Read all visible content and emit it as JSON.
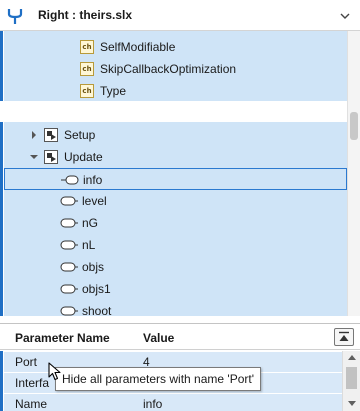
{
  "header": {
    "title": "Right : theirs.slx",
    "app_icon": "merge-fork-icon",
    "menu_icon": "chevron-down-icon"
  },
  "tree": {
    "top_items": [
      {
        "label": "SelfModifiable",
        "icon": "ch"
      },
      {
        "label": "SkipCallbackOptimization",
        "icon": "ch"
      },
      {
        "label": "Type",
        "icon": "ch"
      }
    ],
    "groups": [
      {
        "label": "Setup",
        "expanded": false
      },
      {
        "label": "Update",
        "expanded": true
      }
    ],
    "signals": [
      {
        "label": "info",
        "selected": true
      },
      {
        "label": "level"
      },
      {
        "label": "nG"
      },
      {
        "label": "nL"
      },
      {
        "label": "objs"
      },
      {
        "label": "objs1"
      },
      {
        "label": "shoot"
      }
    ]
  },
  "params": {
    "col_name": "Parameter Name",
    "col_value": "Value",
    "rows": [
      {
        "name": "Port",
        "value": "4"
      },
      {
        "name": "Interfa",
        "value": ""
      },
      {
        "name": "Name",
        "value": "info"
      }
    ]
  },
  "tooltip": {
    "text": "Hide all parameters with name 'Port'"
  },
  "colors": {
    "selection": "#cfe4f7",
    "accent": "#1f6fc5"
  }
}
